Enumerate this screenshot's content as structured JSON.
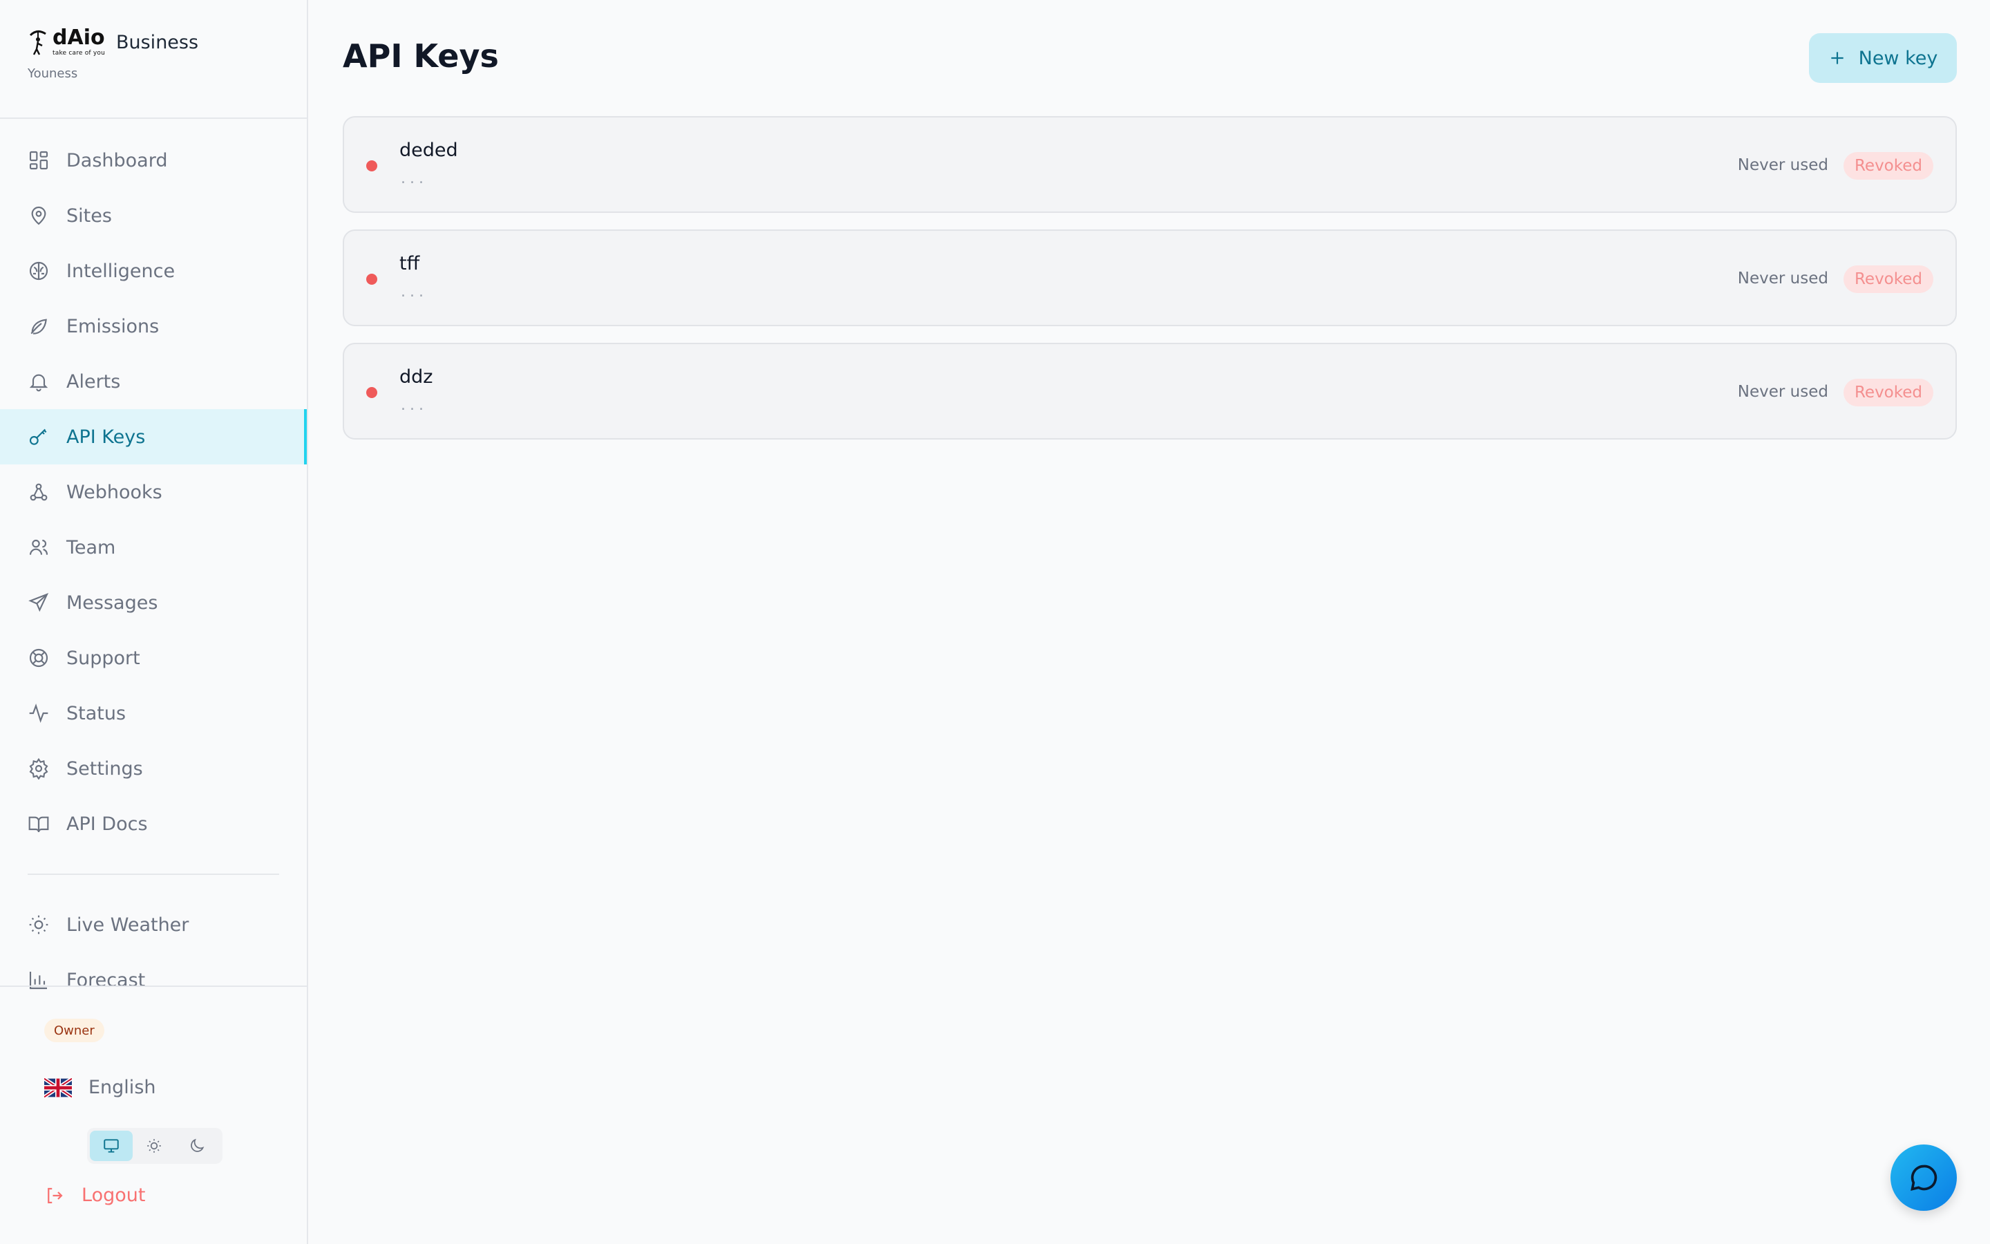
{
  "brand": {
    "logo_text": "dAio",
    "logo_tagline": "take care of you",
    "product": "Business",
    "user": "Youness"
  },
  "nav": {
    "items": [
      {
        "label": "Dashboard",
        "icon": "dashboard-icon"
      },
      {
        "label": "Sites",
        "icon": "map-pin-icon"
      },
      {
        "label": "Intelligence",
        "icon": "brain-icon"
      },
      {
        "label": "Emissions",
        "icon": "leaf-icon"
      },
      {
        "label": "Alerts",
        "icon": "bell-icon"
      },
      {
        "label": "API Keys",
        "icon": "key-icon",
        "active": true
      },
      {
        "label": "Webhooks",
        "icon": "webhook-icon"
      },
      {
        "label": "Team",
        "icon": "users-icon"
      },
      {
        "label": "Messages",
        "icon": "send-icon"
      },
      {
        "label": "Support",
        "icon": "life-buoy-icon"
      },
      {
        "label": "Status",
        "icon": "activity-icon"
      },
      {
        "label": "Settings",
        "icon": "gear-icon"
      },
      {
        "label": "API Docs",
        "icon": "book-icon"
      }
    ],
    "extra_items": [
      {
        "label": "Live Weather",
        "icon": "sun-icon"
      },
      {
        "label": "Forecast",
        "icon": "bar-chart-icon"
      }
    ]
  },
  "footer": {
    "role_badge": "Owner",
    "language": "English",
    "language_flag": "uk-flag-icon",
    "theme_options": [
      "system",
      "light",
      "dark"
    ],
    "theme_selected": "system",
    "logout_label": "Logout"
  },
  "main": {
    "title": "API Keys",
    "new_key_label": "New key",
    "keys": [
      {
        "name": "deded",
        "mask": "...",
        "usage": "Never used",
        "status": "Revoked"
      },
      {
        "name": "tff",
        "mask": "...",
        "usage": "Never used",
        "status": "Revoked"
      },
      {
        "name": "ddz",
        "mask": "...",
        "usage": "Never used",
        "status": "Revoked"
      }
    ]
  },
  "colors": {
    "accent": "#0e7490",
    "accent_bg": "#e0f5fa",
    "revoked_text": "#f48f8f",
    "revoked_bg": "#fde2e2",
    "status_dot": "#ef5a5a",
    "logout": "#f87171"
  }
}
